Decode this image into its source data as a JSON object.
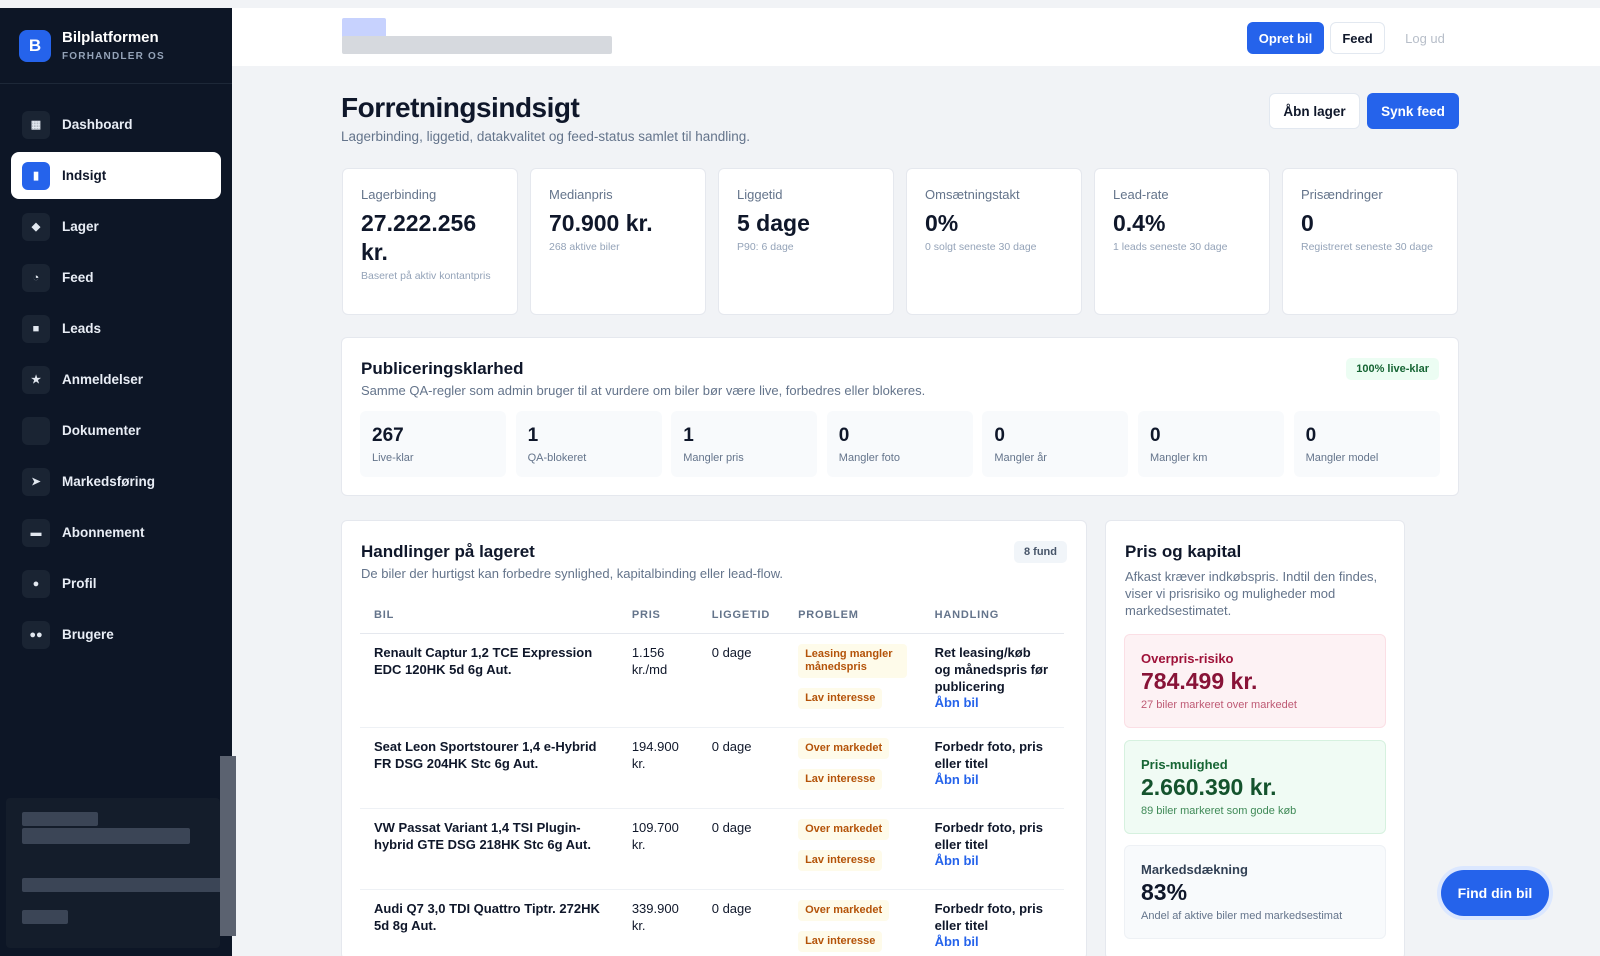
{
  "brand": {
    "logo_letter": "B",
    "title": "Bilplatformen",
    "subtitle": "FORHANDLER OS"
  },
  "sidebar": {
    "items": [
      {
        "label": "Dashboard",
        "icon": "dashboard-icon",
        "glyph": "▦",
        "active": false
      },
      {
        "label": "Indsigt",
        "icon": "chart-icon",
        "glyph": "▮",
        "active": true
      },
      {
        "label": "Lager",
        "icon": "car-icon",
        "glyph": "◆",
        "active": false
      },
      {
        "label": "Feed",
        "icon": "rss-icon",
        "glyph": "◔",
        "active": false
      },
      {
        "label": "Leads",
        "icon": "chat-icon",
        "glyph": "■",
        "active": false
      },
      {
        "label": "Anmeldelser",
        "icon": "star-icon",
        "glyph": "★",
        "active": false
      },
      {
        "label": "Dokumenter",
        "icon": "document-icon",
        "glyph": "",
        "active": false
      },
      {
        "label": "Markedsføring",
        "icon": "send-icon",
        "glyph": "➤",
        "active": false
      },
      {
        "label": "Abonnement",
        "icon": "card-icon",
        "glyph": "▬",
        "active": false
      },
      {
        "label": "Profil",
        "icon": "user-icon",
        "glyph": "●",
        "active": false
      },
      {
        "label": "Brugere",
        "icon": "users-icon",
        "glyph": "●●",
        "active": false
      }
    ]
  },
  "topbar": {
    "create_label": "Opret bil",
    "feed_label": "Feed",
    "logout_label": "Log ud"
  },
  "header": {
    "title": "Forretningsindsigt",
    "subtitle": "Lagerbinding, liggetid, datakvalitet og feed-status samlet til handling.",
    "open_stock_label": "Åbn lager",
    "sync_feed_label": "Synk feed"
  },
  "kpis": [
    {
      "label": "Lagerbinding",
      "value": "27.222.256 kr.",
      "sub": "Baseret på aktiv kontantpris"
    },
    {
      "label": "Medianpris",
      "value": "70.900 kr.",
      "sub": "268 aktive biler"
    },
    {
      "label": "Liggetid",
      "value": "5 dage",
      "sub": "P90: 6 dage"
    },
    {
      "label": "Omsætningstakt",
      "value": "0%",
      "sub": "0 solgt seneste 30 dage"
    },
    {
      "label": "Lead-rate",
      "value": "0.4%",
      "sub": "1 leads seneste 30 dage"
    },
    {
      "label": "Prisændringer",
      "value": "0",
      "sub": "Registreret seneste 30 dage"
    }
  ],
  "readiness": {
    "title": "Publiceringsklarhed",
    "subtitle": "Samme QA-regler som admin bruger til at vurdere om biler bør være live, forbedres eller blokeres.",
    "badge": "100% live-klar",
    "tiles": [
      {
        "value": "267",
        "label": "Live-klar"
      },
      {
        "value": "1",
        "label": "QA-blokeret"
      },
      {
        "value": "1",
        "label": "Mangler pris"
      },
      {
        "value": "0",
        "label": "Mangler foto"
      },
      {
        "value": "0",
        "label": "Mangler år"
      },
      {
        "value": "0",
        "label": "Mangler km"
      },
      {
        "value": "0",
        "label": "Mangler model"
      }
    ]
  },
  "actions": {
    "title": "Handlinger på lageret",
    "subtitle": "De biler der hurtigst kan forbedre synlighed, kapitalbinding eller lead-flow.",
    "badge": "8 fund",
    "columns": [
      "BIL",
      "PRIS",
      "LIGGETID",
      "PROBLEM",
      "HANDLING"
    ],
    "rows": [
      {
        "car": "Renault Captur 1,2 TCE Expression EDC 120HK 5d 6g Aut.",
        "price": "1.156 kr./md",
        "days": "0 dage",
        "problems": [
          "Leasing mangler månedspris",
          "Lav interesse"
        ],
        "action": "Ret leasing/køb og månedspris før publicering",
        "link": "Åbn bil"
      },
      {
        "car": "Seat Leon Sportstourer 1,4 e-Hybrid FR DSG 204HK Stc 6g Aut.",
        "price": "194.900 kr.",
        "days": "0 dage",
        "problems": [
          "Over markedet",
          "Lav interesse"
        ],
        "action": "Forbedr foto, pris eller titel",
        "link": "Åbn bil"
      },
      {
        "car": "VW Passat Variant 1,4 TSI Plugin-hybrid GTE DSG 218HK Stc 6g Aut.",
        "price": "109.700 kr.",
        "days": "0 dage",
        "problems": [
          "Over markedet",
          "Lav interesse"
        ],
        "action": "Forbedr foto, pris eller titel",
        "link": "Åbn bil"
      },
      {
        "car": "Audi Q7 3,0 TDI Quattro Tiptr. 272HK 5d 8g Aut.",
        "price": "339.900 kr.",
        "days": "0 dage",
        "problems": [
          "Over markedet",
          "Lav interesse"
        ],
        "action": "Forbedr foto, pris eller titel",
        "link": "Åbn bil"
      }
    ]
  },
  "capital": {
    "title": "Pris og kapital",
    "subtitle": "Afkast kræver indkøbspris. Indtil den findes, viser vi prisrisiko og muligheder mod markedsestimatet.",
    "boxes": [
      {
        "label": "Overpris-risiko",
        "value": "784.499 kr.",
        "sub": "27 biler markeret over markedet",
        "tone": "red"
      },
      {
        "label": "Pris-mulighed",
        "value": "2.660.390 kr.",
        "sub": "89 biler markeret som gode køb",
        "tone": "green"
      },
      {
        "label": "Markedsdækning",
        "value": "83%",
        "sub": "Andel af aktive biler med markedsestimat",
        "tone": "neutral"
      }
    ]
  },
  "fab_label": "Find din bil",
  "colors": {
    "accent": "#2563eb",
    "sidebar": "#0d1626",
    "warning": "#b45309",
    "danger": "#9f1239",
    "success": "#166534"
  }
}
